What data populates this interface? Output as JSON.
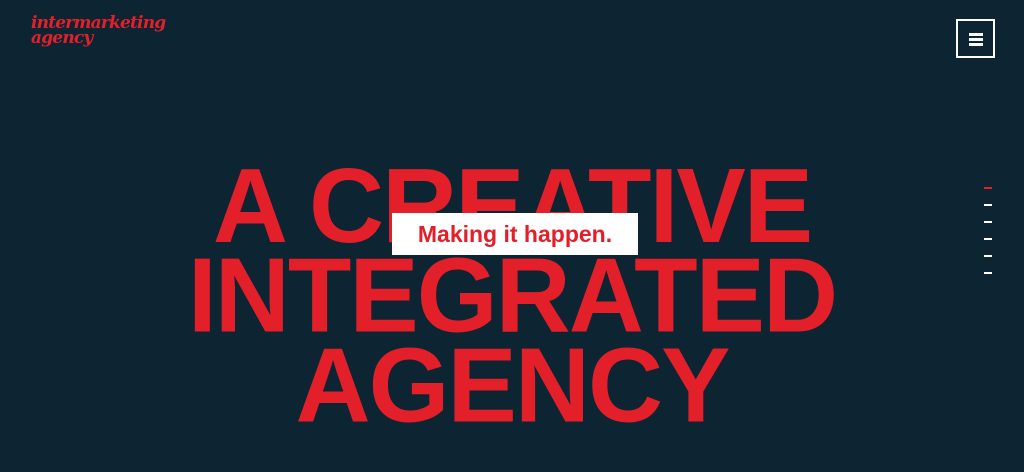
{
  "logo": {
    "line1": "intermarketing",
    "line2": "agency"
  },
  "menu": {
    "icon": "hamburger-icon"
  },
  "hero": {
    "lines": [
      "A CREATIVE",
      "INTEGRATED",
      "AGENCY"
    ],
    "tagline": "Making it happen."
  },
  "pagination": {
    "count": 6,
    "active_index": 0
  },
  "colors": {
    "background": "#0d2433",
    "accent": "#e3202a",
    "white": "#ffffff"
  }
}
